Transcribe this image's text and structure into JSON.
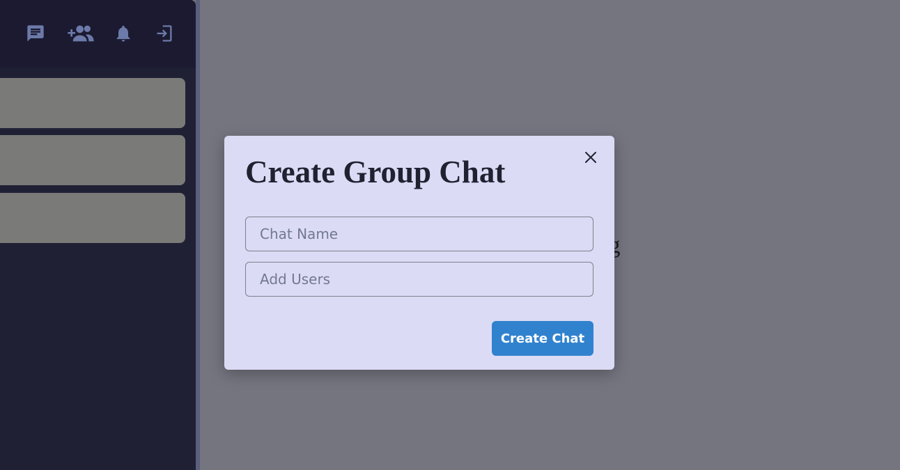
{
  "header": {
    "icons": [
      "chat-icon",
      "add-group-icon",
      "bell-icon",
      "logout-icon"
    ]
  },
  "sidebar": {
    "chat_items": [
      {},
      {},
      {}
    ]
  },
  "main": {
    "empty_message": "o start chatting"
  },
  "modal": {
    "title": "Create Group Chat",
    "chat_name_placeholder": "Chat Name",
    "chat_name_value": "",
    "add_users_placeholder": "Add Users",
    "add_users_value": "",
    "create_button_label": "Create Chat"
  },
  "colors": {
    "accent": "#3182ce",
    "modal_bg": "#dcdbf5",
    "sidebar_bg": "#202035",
    "header_icon": "#6c7aa9"
  }
}
